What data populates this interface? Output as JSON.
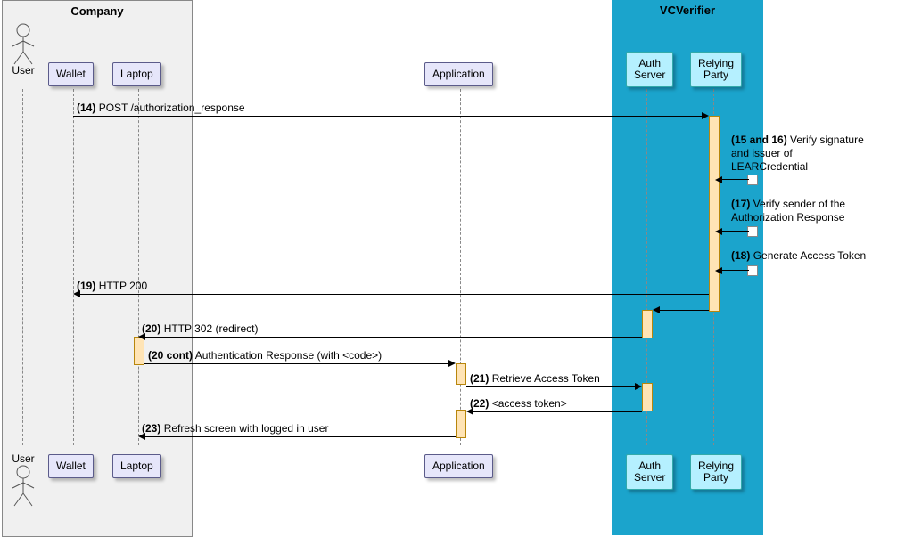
{
  "chart_data": {
    "type": "sequence_diagram",
    "groups": [
      {
        "name": "Company",
        "participants": [
          "User",
          "Wallet",
          "Laptop"
        ]
      },
      {
        "name": "VCVerifier",
        "participants": [
          "Auth Server",
          "Relying Party"
        ]
      }
    ],
    "participants": [
      "User",
      "Wallet",
      "Laptop",
      "Application",
      "Auth Server",
      "Relying Party"
    ],
    "messages": [
      {
        "n": "14",
        "from": "Wallet",
        "to": "Relying Party",
        "text": "POST /authorization_response"
      },
      {
        "n": "15 and 16",
        "self": "Relying Party",
        "text": "Verify signature and issuer of LEARCredential"
      },
      {
        "n": "17",
        "self": "Relying Party",
        "text": "Verify sender of the Authorization Response"
      },
      {
        "n": "18",
        "self": "Relying Party",
        "text": "Generate Access Token"
      },
      {
        "n": "19",
        "from": "Relying Party",
        "to": "Wallet",
        "text": "HTTP 200"
      },
      {
        "n": "",
        "from": "Relying Party",
        "to": "Auth Server",
        "text": ""
      },
      {
        "n": "20",
        "from": "Auth Server",
        "to": "Laptop",
        "text": "HTTP 302 (redirect)"
      },
      {
        "n": "20 cont",
        "from": "Laptop",
        "to": "Application",
        "text": "Authentication Response (with <code>)"
      },
      {
        "n": "21",
        "from": "Application",
        "to": "Auth Server",
        "text": "Retrieve Access Token"
      },
      {
        "n": "22",
        "from": "Auth Server",
        "to": "Application",
        "text": "<access token>"
      },
      {
        "n": "23",
        "from": "Application",
        "to": "Laptop",
        "text": "Refresh screen with logged in user"
      }
    ]
  },
  "groups": {
    "company": "Company",
    "vcverifier": "VCVerifier"
  },
  "participants": {
    "user": "User",
    "wallet": "Wallet",
    "laptop": "Laptop",
    "application": "Application",
    "authserver": "Auth\nServer",
    "relying": "Relying\nParty"
  },
  "messages": {
    "m14": {
      "n": "(14)",
      "t": "POST /authorization_response"
    },
    "m15": {
      "n": "(15 and 16)",
      "t": "Verify signature and issuer of LEARCredential"
    },
    "m17": {
      "n": "(17)",
      "t": "Verify sender of the Authorization Response"
    },
    "m18": {
      "n": "(18)",
      "t": "Generate Access Token"
    },
    "m19": {
      "n": "(19)",
      "t": "HTTP 200"
    },
    "m20": {
      "n": "(20)",
      "t": "HTTP 302 (redirect)"
    },
    "m20c": {
      "n": "(20 cont)",
      "t": "Authentication Response (with <code>)"
    },
    "m21": {
      "n": "(21)",
      "t": "Retrieve Access Token"
    },
    "m22": {
      "n": "(22)",
      "t": "<access token>"
    },
    "m23": {
      "n": "(23)",
      "t": "Refresh screen with logged in user"
    }
  }
}
